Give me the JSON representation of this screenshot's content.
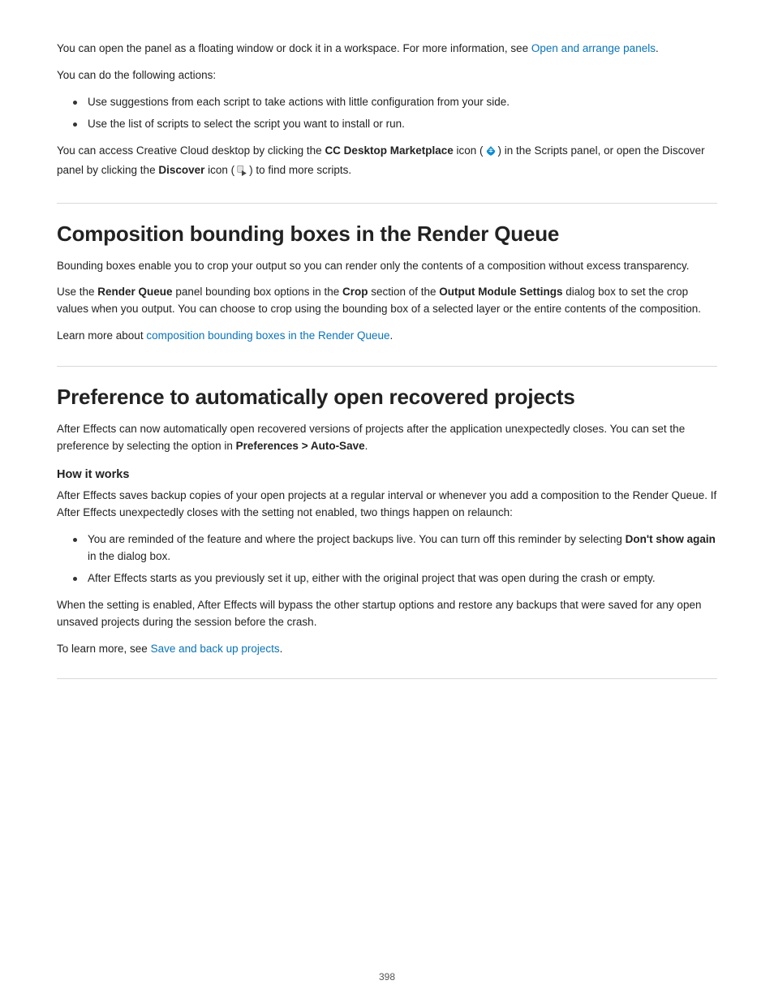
{
  "section1": {
    "intro": "You can open the panel as a floating window or dock it in a workspace. For more information, see ",
    "intro_link": "Open and arrange panels",
    "intro_end": ".",
    "listLead": "You can do the following actions:",
    "bullets": [
      "Use suggestions from each script to take actions with little configuration from your side.",
      "Use the list of scripts to select the script you want to install or run."
    ],
    "ccdPara": {
      "pre": "You can access Creative Cloud desktop by clicking the ",
      "bold1": "CC Desktop Marketplace",
      "mid1": " icon (",
      "mid2": ") in the Scripts panel, or open the Discover panel by clicking the ",
      "bold2": "Discover",
      "mid3": " icon (",
      "mid4": ") to find more scripts.",
      "icon1_name": "cc-desktop-marketplace-icon",
      "icon2_name": "discover-icon"
    }
  },
  "section2": {
    "title": "Composition bounding boxes in the Render Queue",
    "p1": "Bounding boxes enable you to crop your output so you can render only the contents of a composition without excess transparency.",
    "p2": {
      "pre": "Use the ",
      "b1": "Render Queue",
      "mid1": " panel bounding box options in the ",
      "b2": "Crop",
      "mid2": " section of the ",
      "b3": "Output Module Settings",
      "end": " dialog box to set the crop values when you output. You can choose to crop using the bounding box of a selected layer or the entire contents of the composition."
    },
    "p3": {
      "pre": "Learn more about ",
      "link": "composition bounding boxes in the Render Queue",
      "end": "."
    }
  },
  "section3": {
    "title": "Preference to automatically open recovered projects",
    "p1": {
      "pre": "After Effects can now automatically open recovered versions of projects after the application unexpectedly closes. You can set the preference by selecting the option in ",
      "path": "Preferences > Auto-Save",
      "end": "."
    },
    "h2": "How it works",
    "p2": "After Effects saves backup copies of your open projects at a regular interval or whenever you add a composition to the Render Queue. If After Effects unexpectedly closes with the setting not enabled, two things happen on relaunch:",
    "bullets": [
      {
        "pre": "You are reminded of the feature and where the project backups live. You can turn off this reminder by selecting ",
        "b1": "Don't show again",
        "mid": " in the dialog box.",
        "suffix": ""
      },
      {
        "pre": "",
        "b1": "",
        "mid": "",
        "suffix": "After Effects starts as you previously set it up, either with the original project that was open during the crash or empty."
      }
    ],
    "p3": "When the setting is enabled, After Effects will bypass the other startup options and restore any backups that were saved for any open unsaved projects during the session before the crash.",
    "p4": {
      "pre": "To learn more, see ",
      "link": "Save and back up projects",
      "end": "."
    }
  },
  "pageNumber": "398"
}
